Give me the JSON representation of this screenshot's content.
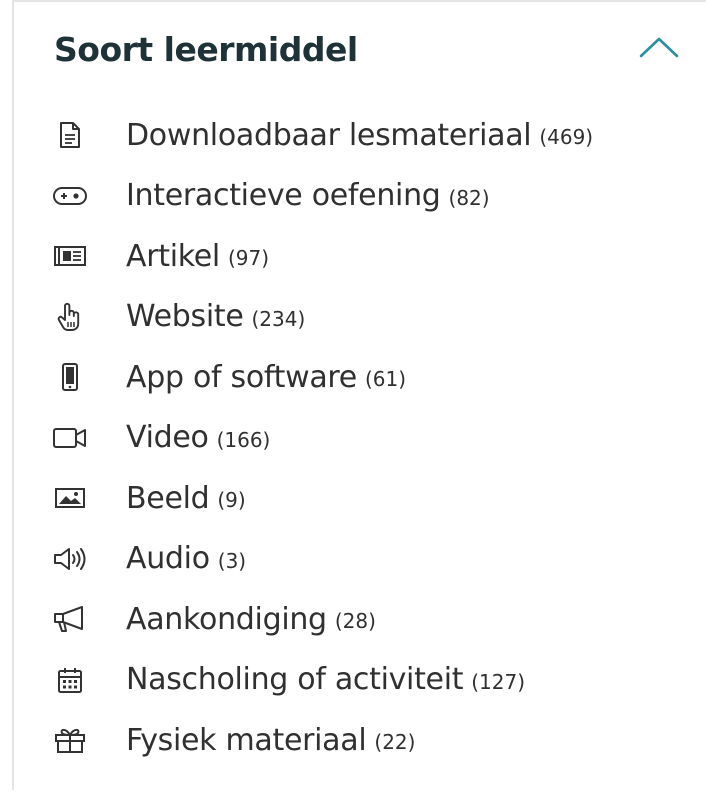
{
  "filter": {
    "title": "Soort leermiddel",
    "expanded": true,
    "toggle_icon": "chevron-up-icon",
    "accent_color": "#2a8fa0",
    "options": [
      {
        "label": "Downloadbaar lesmateriaal",
        "count": "(469)",
        "icon": "document-icon"
      },
      {
        "label": "Interactieve oefening",
        "count": "(82)",
        "icon": "gamepad-icon"
      },
      {
        "label": "Artikel",
        "count": "(97)",
        "icon": "newspaper-icon"
      },
      {
        "label": "Website",
        "count": "(234)",
        "icon": "pointer-hand-icon"
      },
      {
        "label": "App of software",
        "count": "(61)",
        "icon": "smartphone-icon"
      },
      {
        "label": "Video",
        "count": "(166)",
        "icon": "video-camera-icon"
      },
      {
        "label": "Beeld",
        "count": "(9)",
        "icon": "image-icon"
      },
      {
        "label": "Audio",
        "count": "(3)",
        "icon": "speaker-icon"
      },
      {
        "label": "Aankondiging",
        "count": "(28)",
        "icon": "megaphone-icon"
      },
      {
        "label": "Nascholing of activiteit",
        "count": "(127)",
        "icon": "calendar-icon"
      },
      {
        "label": "Fysiek materiaal",
        "count": "(22)",
        "icon": "gift-box-icon"
      }
    ]
  }
}
